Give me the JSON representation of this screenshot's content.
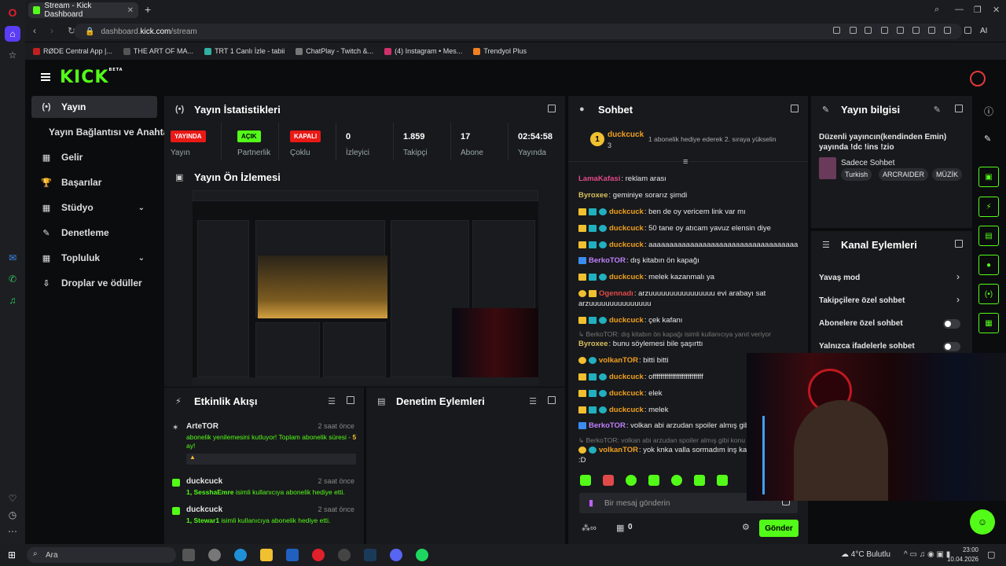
{
  "browser": {
    "tab_title": "Stream - Kick Dashboard",
    "url_prefix": "dashboard.",
    "url_domain": "kick.com",
    "url_path": "/stream",
    "bookmarks": [
      "RØDE Central App |...",
      "THE ART OF MA...",
      "TRT 1 Canlı İzle - tabii",
      "ChatPlay - Twitch &...",
      "(4) Instagram • Mes...",
      "Trendyol Plus"
    ],
    "ai_label": "AI"
  },
  "logo": "KICK",
  "logo_beta": "BETA",
  "nav": [
    {
      "label": "Yayın",
      "icon": "(•)"
    },
    {
      "label": "Yayın Bağlantısı ve Anahtarı",
      "icon": ""
    },
    {
      "label": "Gelir",
      "icon": "▦"
    },
    {
      "label": "Başarılar",
      "icon": "🏆"
    },
    {
      "label": "Stüdyo",
      "icon": "▦"
    },
    {
      "label": "Denetleme",
      "icon": "✎"
    },
    {
      "label": "Topluluk",
      "icon": "▦"
    },
    {
      "label": "Droplar ve ödüller",
      "icon": "⇩"
    }
  ],
  "stats": {
    "title": "Yayın İstatistikleri",
    "items": [
      {
        "badge": "YAYINDA",
        "label": "Yayın"
      },
      {
        "badge": "AÇIK",
        "label": "Partnerlik"
      },
      {
        "badge": "KAPALI",
        "label": "Çoklu"
      },
      {
        "value": "0",
        "label": "İzleyici"
      },
      {
        "value": "1.859",
        "label": "Takipçi"
      },
      {
        "value": "17",
        "label": "Abone"
      },
      {
        "value": "02:54:58",
        "label": "Yayında"
      }
    ]
  },
  "preview": {
    "title": "Yayın Ön İzlemesi"
  },
  "events": {
    "title": "Etkinlik Akışı",
    "items": [
      {
        "user": "ArteTOR",
        "time": "2 saat önce",
        "text": "abonelik yenilemesini kutluyor! Toplam abonelik süresi - ",
        "num": "5",
        "suffix": " ay!"
      },
      {
        "user": "duckcuck",
        "time": "2 saat önce",
        "num": "1,",
        "target": "SesshaEmre",
        "text": " isimli kullanıcıya abonelik hediye etti."
      },
      {
        "user": "duckcuck",
        "time": "2 saat önce",
        "num": "1,",
        "target": "Stewar1",
        "text": " isimli kullanıcıya abonelik hediye etti."
      }
    ]
  },
  "moderation": {
    "title": "Denetim Eylemleri"
  },
  "chat": {
    "title": "Sohbet",
    "pinned_user": "duckcuck",
    "pinned_count": "3",
    "pinned_text": "1 abonelik hediye ederek 2. sıraya yükselin",
    "messages": [
      {
        "user": "LamaKafasi",
        "color": "#e04a8a",
        "text": "reklam arası"
      },
      {
        "user": "Byroxee",
        "color": "#d8c060",
        "text": "geminiye sorarız şimdi"
      },
      {
        "user": "duckcuck",
        "color": "#f0a020",
        "text": "ben de oy vericem link var mı"
      },
      {
        "user": "duckcuck",
        "color": "#f0a020",
        "text": "50 tane oy atıcam yavuz elensin diye"
      },
      {
        "user": "duckcuck",
        "color": "#f0a020",
        "text": "aaaaaaaaaaaaaaaaaaaaaaaaaaaaaaaaaaaa"
      },
      {
        "user": "BerkoTOR",
        "color": "#c080ff",
        "text": "dış kitabın ön kapağı"
      },
      {
        "user": "duckcuck",
        "color": "#f0a020",
        "text": "melek kazanmalı ya"
      },
      {
        "user": "Ogennadı",
        "color": "#e04a4a",
        "text": "arzuuuuuuuuuuuuuuuu evi arabayı sat"
      },
      {
        "user": "",
        "color": "",
        "text": "arzuuuuuuuuuuuuuuu"
      },
      {
        "user": "duckcuck",
        "color": "#f0a020",
        "text": "çek kafanı"
      },
      {
        "user": "",
        "color": "",
        "text": "BerkoTOR: dış kitabın ön kapağı isimli kullanıcıya yanıt veriyor"
      },
      {
        "user": "Byroxee",
        "color": "#d8c060",
        "text": "bunu söylemesi bile şaşırttı"
      },
      {
        "user": "volkanTOR",
        "color": "#f0a020",
        "text": "bitti bitti"
      },
      {
        "user": "duckcuck",
        "color": "#f0a020",
        "text": "offffffffffffffffffffffffff"
      },
      {
        "user": "duckcuck",
        "color": "#f0a020",
        "text": "elek"
      },
      {
        "user": "duckcuck",
        "color": "#f0a020",
        "text": "melek"
      },
      {
        "user": "BerkoTOR",
        "color": "#c080ff",
        "text": "volkan abi arzudan spoiler almış gibi k"
      },
      {
        "user": "",
        "color": "",
        "text": "BerkoTOR: volkan abi arzudan spoiler almış gibi konu"
      },
      {
        "user": "volkanTOR",
        "color": "#f0a020",
        "text": "yok knka valla sormadım inş kaza"
      },
      {
        "user": "",
        "color": "",
        "text": ":D"
      }
    ],
    "input_placeholder": "Bir mesaj gönderin",
    "points": "0",
    "send_label": "Gönder"
  },
  "stream_info": {
    "title": "Yayın bilgisi",
    "desc": "Düzenli yayıncın(kendinden Emin) yayında !dc !ins !zio",
    "category": "Sadece Sohbet",
    "tags": [
      "Turkish",
      "ARCRAIDER",
      "MÜZİK"
    ]
  },
  "channel_actions": {
    "title": "Kanal Eylemleri",
    "items": [
      "Yavaş mod",
      "Takipçilere özel sohbet",
      "Abonelere özel sohbet",
      "Yalnızca ifadelerle sohbet"
    ]
  },
  "taskbar": {
    "search_label": "Ara",
    "weather": "4°C  Bulutlu",
    "time": "23:00",
    "date": "10.04.2026"
  },
  "colors": {
    "accent": "#53fc18",
    "live": "#e91916"
  }
}
